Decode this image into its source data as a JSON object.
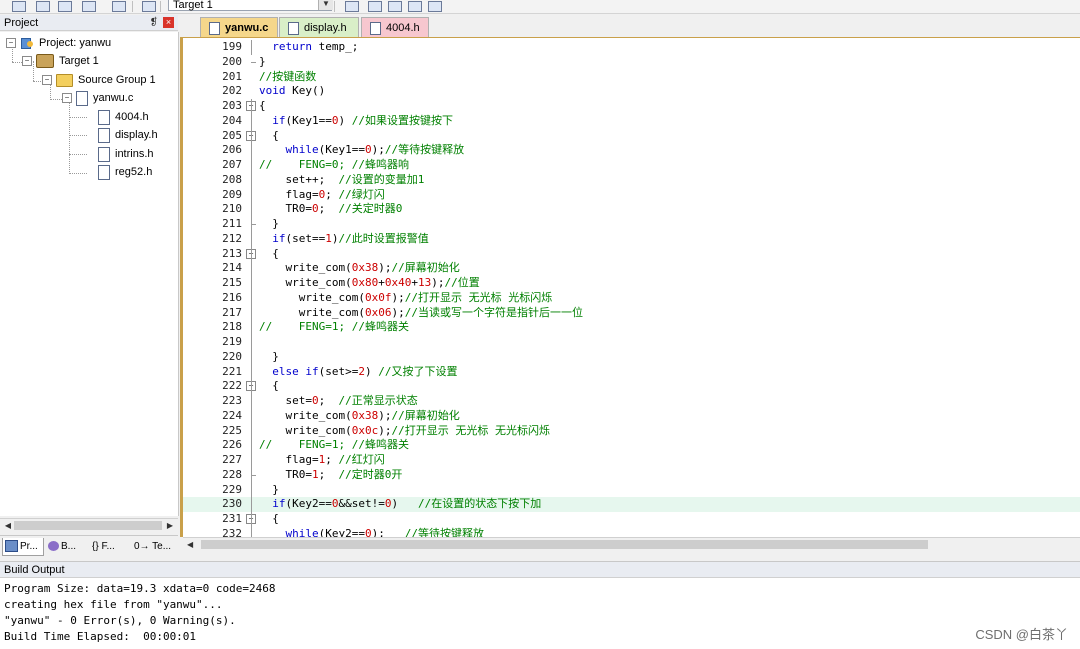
{
  "toolbar": {
    "target_select": "Target 1"
  },
  "project_panel": {
    "title": "Project",
    "pin_symbol": "❡",
    "close_symbol": "×",
    "tree": [
      {
        "label": "Project: yanwu",
        "icon": "project-icon"
      },
      {
        "label": "Target 1",
        "icon": "target-icon"
      },
      {
        "label": "Source Group 1",
        "icon": "folder-icon"
      },
      {
        "label": "yanwu.c",
        "icon": "file-icon"
      },
      {
        "label": "4004.h",
        "icon": "file-icon"
      },
      {
        "label": "display.h",
        "icon": "file-icon"
      },
      {
        "label": "intrins.h",
        "icon": "file-icon"
      },
      {
        "label": "reg52.h",
        "icon": "file-icon"
      }
    ],
    "bottom_tabs": [
      {
        "label": "Pr...",
        "icon": "project-tab-icon"
      },
      {
        "label": "B...",
        "icon": "books-tab-icon"
      },
      {
        "label": "{} F...",
        "icon": "functions-tab-icon"
      },
      {
        "label": "0→ Te...",
        "icon": "templates-tab-icon"
      }
    ]
  },
  "editor": {
    "tabs": [
      {
        "label": "yanwu.c",
        "active": true,
        "color": "#f5d78b"
      },
      {
        "label": "display.h",
        "active": false,
        "color": "#d9efc8"
      },
      {
        "label": "4004.h",
        "active": false,
        "color": "#f7c7cf"
      }
    ],
    "highlight_line": "230",
    "lines": [
      {
        "n": "199",
        "t": "  return temp_;"
      },
      {
        "n": "200",
        "t": "}"
      },
      {
        "n": "201",
        "t": "//按键函数"
      },
      {
        "n": "202",
        "t": "void Key()"
      },
      {
        "n": "203",
        "t": "{"
      },
      {
        "n": "204",
        "t": "  if(Key1==0) //如果设置按键按下"
      },
      {
        "n": "205",
        "t": "  {"
      },
      {
        "n": "206",
        "t": "    while(Key1==0);//等待按键释放"
      },
      {
        "n": "207",
        "t": "//    FENG=0; //蜂鸣器响"
      },
      {
        "n": "208",
        "t": "    set++;  //设置的变量加1"
      },
      {
        "n": "209",
        "t": "    flag=0; //绿灯闪"
      },
      {
        "n": "210",
        "t": "    TR0=0;  //关定时器0"
      },
      {
        "n": "211",
        "t": "  }"
      },
      {
        "n": "212",
        "t": "  if(set==1)//此时设置报警值"
      },
      {
        "n": "213",
        "t": "  {"
      },
      {
        "n": "214",
        "t": "    write_com(0x38);//屏幕初始化"
      },
      {
        "n": "215",
        "t": "    write_com(0x80+0x40+13);//位置"
      },
      {
        "n": "216",
        "t": "      write_com(0x0f);//打开显示 无光标 光标闪烁"
      },
      {
        "n": "217",
        "t": "      write_com(0x06);//当读或写一个字符是指针后一一位"
      },
      {
        "n": "218",
        "t": "//    FENG=1; //蜂鸣器关"
      },
      {
        "n": "219",
        "t": ""
      },
      {
        "n": "220",
        "t": "  }"
      },
      {
        "n": "221",
        "t": "  else if(set>=2) //又按了下设置"
      },
      {
        "n": "222",
        "t": "  {"
      },
      {
        "n": "223",
        "t": "    set=0;  //正常显示状态"
      },
      {
        "n": "224",
        "t": "    write_com(0x38);//屏幕初始化"
      },
      {
        "n": "225",
        "t": "    write_com(0x0c);//打开显示 无光标 无光标闪烁"
      },
      {
        "n": "226",
        "t": "//    FENG=1; //蜂鸣器关"
      },
      {
        "n": "227",
        "t": "    flag=1; //红灯闪"
      },
      {
        "n": "228",
        "t": "    TR0=1;  //定时器0开"
      },
      {
        "n": "229",
        "t": "  }"
      },
      {
        "n": "230",
        "t": "  if(Key2==0&&set!=0)   //在设置的状态下按下加"
      },
      {
        "n": "231",
        "t": "  {"
      },
      {
        "n": "232",
        "t": "    while(Key2==0);   //等待按键释放"
      }
    ]
  },
  "build_output": {
    "title": "Build Output",
    "lines": [
      "Program Size: data=19.3 xdata=0 code=2468",
      "creating hex file from \"yanwu\"...",
      "\"yanwu\" - 0 Error(s), 0 Warning(s).",
      "Build Time Elapsed:  00:00:01"
    ]
  },
  "watermark": "CSDN @白茶丫"
}
